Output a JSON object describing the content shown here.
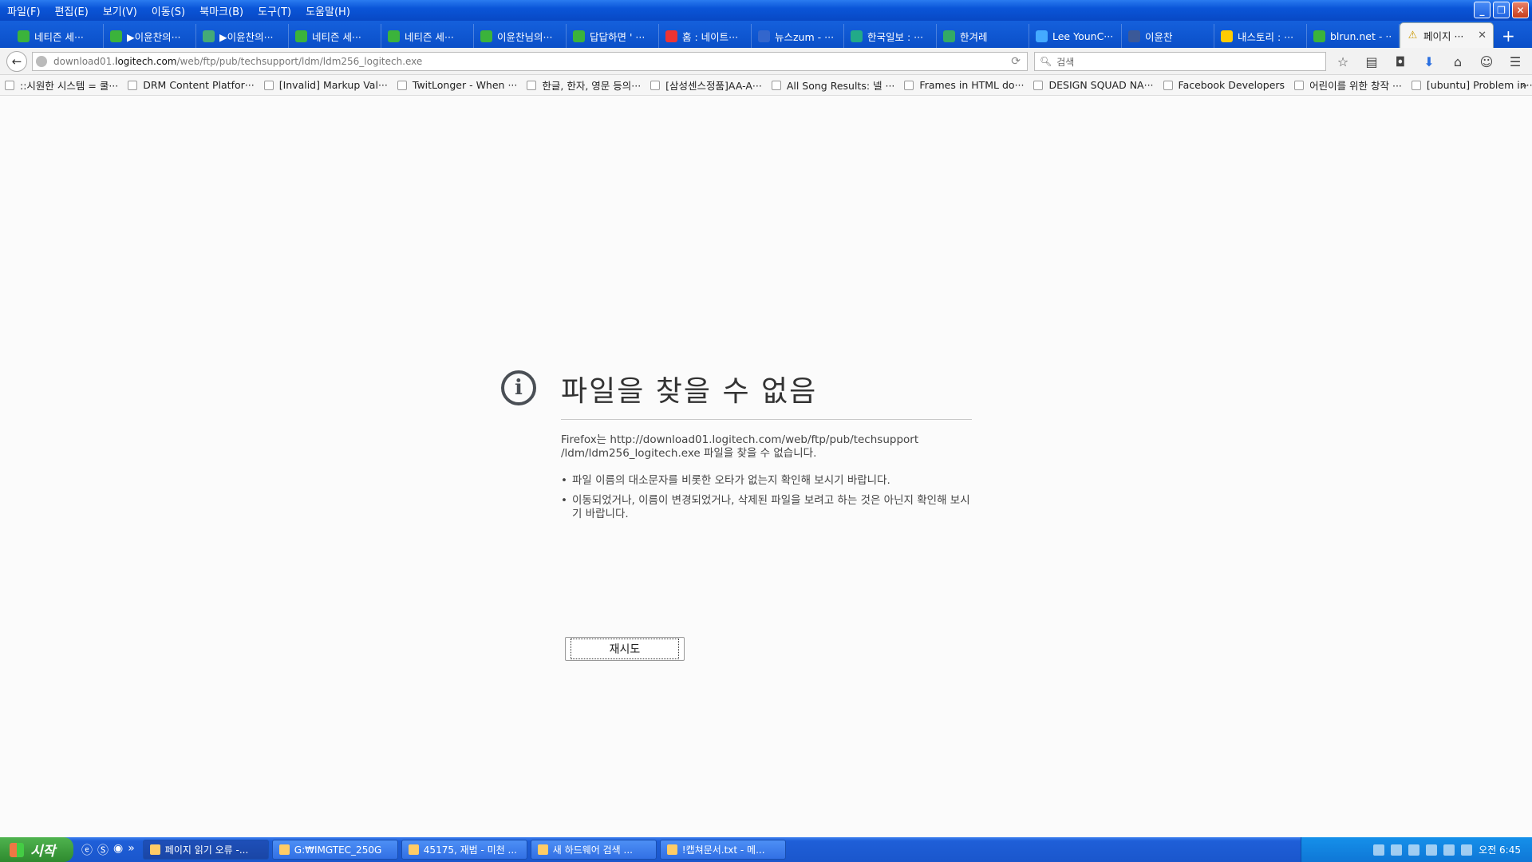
{
  "menu": [
    "파일(F)",
    "편집(E)",
    "보기(V)",
    "이동(S)",
    "북마크(B)",
    "도구(T)",
    "도움말(H)"
  ],
  "tabs": [
    {
      "label": "네티즌 세···",
      "icon": "naver-leaf-icon",
      "color": "#3bb33b"
    },
    {
      "label": "▶이윤찬의···",
      "icon": "naver-leaf-icon",
      "color": "#3bb33b"
    },
    {
      "label": "▶이윤찬의···",
      "icon": "drive-icon",
      "color": "#4a7"
    },
    {
      "label": "네티즌 세···",
      "icon": "naver-leaf-icon",
      "color": "#3bb33b"
    },
    {
      "label": "네티즌 세···",
      "icon": "naver-leaf-icon",
      "color": "#3bb33b"
    },
    {
      "label": "이윤찬님의···",
      "icon": "naver-leaf-icon",
      "color": "#3bb33b"
    },
    {
      "label": "답답하면 ' ···",
      "icon": "naver-leaf-icon",
      "color": "#3bb33b"
    },
    {
      "label": "홈 : 네이트···",
      "icon": "nate-icon",
      "color": "#e33"
    },
    {
      "label": "뉴스zum - ···",
      "icon": "zum-icon",
      "color": "#36c"
    },
    {
      "label": "한국일보 : ···",
      "icon": "hankook-icon",
      "color": "#2a8"
    },
    {
      "label": "한겨레",
      "icon": "hani-icon",
      "color": "#3a6"
    },
    {
      "label": "Lee YounC···",
      "icon": "twitter-icon",
      "color": "#4af"
    },
    {
      "label": "이윤찬",
      "icon": "facebook-icon",
      "color": "#3b5998"
    },
    {
      "label": "내스토리 : ···",
      "icon": "story-icon",
      "color": "#fc0"
    },
    {
      "label": "blrun.net - ···",
      "icon": "naver-leaf-icon",
      "color": "#3bb33b"
    }
  ],
  "active_tab": {
    "label": "페이지 ···",
    "icon": "warning-icon"
  },
  "url": {
    "prefix": "download01.",
    "domain": "logitech.com",
    "path": "/web/ftp/pub/techsupport/ldm/ldm256_logitech.exe"
  },
  "search": {
    "placeholder": "검색"
  },
  "bookmarks": [
    "::시원한 시스템 = 쿨···",
    "DRM Content Platfor···",
    "[Invalid] Markup Val···",
    "TwitLonger - When ···",
    "한글, 한자, 영문 등의···",
    "[삼성센스정품]AA-A···",
    "All Song Results: 넬 ···",
    "Frames in HTML do···",
    "DESIGN SQUAD NA···",
    "Facebook Developers",
    "어린이를 위한 창작 ···",
    "[ubuntu] Problem in···"
  ],
  "error": {
    "title": "파일을 찾을 수 없음",
    "description": "Firefox는 http://download01.logitech.com/web/ftp/pub/techsupport /ldm/ldm256_logitech.exe 파일을 찾을 수 없습니다.",
    "hints": [
      "파일 이름의 대소문자를 비롯한 오타가 없는지 확인해 보시기 바랍니다.",
      "이동되었거나, 이름이 변경되었거나, 삭제된 파일을 보려고 하는 것은 아닌지 확인해 보시기 바랍니다."
    ],
    "retry_label": "재시도"
  },
  "taskbar": {
    "start_label": "시작",
    "tasks": [
      "페이지 읽기 오류 -...",
      "G:₩IMGTEC_250G",
      "45175, 재범 - 미천 ...",
      "새 하드웨어 검색 ...",
      "!캡쳐문서.txt - 메..."
    ],
    "clock": "오전 6:45"
  }
}
